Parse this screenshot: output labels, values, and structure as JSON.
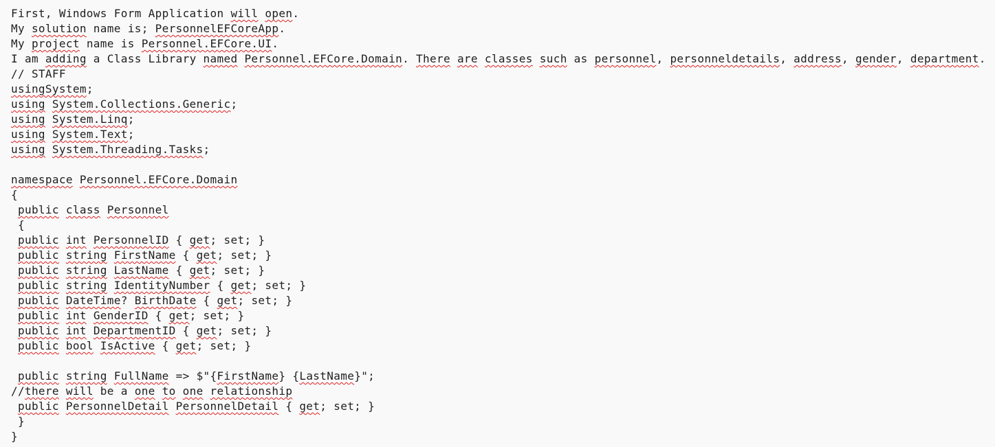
{
  "document": {
    "lines": [
      [
        {
          "t": "First, Windows Form Application "
        },
        {
          "t": "will",
          "s": 1
        },
        {
          "t": " "
        },
        {
          "t": "open",
          "s": 1
        },
        {
          "t": "."
        }
      ],
      [
        {
          "t": "My "
        },
        {
          "t": "solution",
          "s": 1
        },
        {
          "t": " name is; "
        },
        {
          "t": "PersonnelEFCoreApp",
          "s": 1
        },
        {
          "t": "."
        }
      ],
      [
        {
          "t": "My "
        },
        {
          "t": "project",
          "s": 1
        },
        {
          "t": " name is "
        },
        {
          "t": "Personnel.EFCore.UI",
          "s": 1
        },
        {
          "t": "."
        }
      ],
      [
        {
          "t": "I am "
        },
        {
          "t": "adding",
          "s": 1
        },
        {
          "t": " a Class Library "
        },
        {
          "t": "named",
          "s": 1
        },
        {
          "t": " "
        },
        {
          "t": "Personnel.EFCore.Domain",
          "s": 1
        },
        {
          "t": ". "
        },
        {
          "t": "There",
          "s": 1
        },
        {
          "t": " "
        },
        {
          "t": "are",
          "s": 1
        },
        {
          "t": " "
        },
        {
          "t": "classes",
          "s": 1
        },
        {
          "t": " "
        },
        {
          "t": "such",
          "s": 1
        },
        {
          "t": " as "
        },
        {
          "t": "personnel",
          "s": 1
        },
        {
          "t": ", "
        },
        {
          "t": "personneldetails",
          "s": 1
        },
        {
          "t": ", "
        },
        {
          "t": "address",
          "s": 1
        },
        {
          "t": ", "
        },
        {
          "t": "gender",
          "s": 1
        },
        {
          "t": ", "
        },
        {
          "t": "department",
          "s": 1
        },
        {
          "t": "."
        }
      ],
      [
        {
          "t": "// STAFF"
        }
      ],
      [
        {
          "t": "usingSystem",
          "s": 1
        },
        {
          "t": ";"
        }
      ],
      [
        {
          "t": "using",
          "s": 1
        },
        {
          "t": " "
        },
        {
          "t": "System.Collections.Generic",
          "s": 1
        },
        {
          "t": ";"
        }
      ],
      [
        {
          "t": "using",
          "s": 1
        },
        {
          "t": " "
        },
        {
          "t": "System.Linq",
          "s": 1
        },
        {
          "t": ";"
        }
      ],
      [
        {
          "t": "using",
          "s": 1
        },
        {
          "t": " "
        },
        {
          "t": "System.Text",
          "s": 1
        },
        {
          "t": ";"
        }
      ],
      [
        {
          "t": "using",
          "s": 1
        },
        {
          "t": " "
        },
        {
          "t": "System.Threading.Tasks",
          "s": 1
        },
        {
          "t": ";"
        }
      ],
      [
        {
          "t": ""
        }
      ],
      [
        {
          "t": "namespace",
          "s": 1
        },
        {
          "t": " "
        },
        {
          "t": "Personnel.EFCore.Domain",
          "s": 1
        }
      ],
      [
        {
          "t": "{"
        }
      ],
      [
        {
          "t": " "
        },
        {
          "t": "public",
          "s": 1
        },
        {
          "t": " "
        },
        {
          "t": "class",
          "s": 1
        },
        {
          "t": " "
        },
        {
          "t": "Personnel",
          "s": 1
        }
      ],
      [
        {
          "t": " {"
        }
      ],
      [
        {
          "t": " "
        },
        {
          "t": "public",
          "s": 1
        },
        {
          "t": " "
        },
        {
          "t": "int",
          "s": 1
        },
        {
          "t": " "
        },
        {
          "t": "PersonnelID",
          "s": 1
        },
        {
          "t": " { "
        },
        {
          "t": "get",
          "s": 1
        },
        {
          "t": "; set; }"
        }
      ],
      [
        {
          "t": " "
        },
        {
          "t": "public",
          "s": 1
        },
        {
          "t": " "
        },
        {
          "t": "string",
          "s": 1
        },
        {
          "t": " "
        },
        {
          "t": "FirstName",
          "s": 1
        },
        {
          "t": " { "
        },
        {
          "t": "get",
          "s": 1
        },
        {
          "t": "; set; }"
        }
      ],
      [
        {
          "t": " "
        },
        {
          "t": "public",
          "s": 1
        },
        {
          "t": " "
        },
        {
          "t": "string",
          "s": 1
        },
        {
          "t": " "
        },
        {
          "t": "LastName",
          "s": 1
        },
        {
          "t": " { "
        },
        {
          "t": "get",
          "s": 1
        },
        {
          "t": "; set; }"
        }
      ],
      [
        {
          "t": " "
        },
        {
          "t": "public",
          "s": 1
        },
        {
          "t": " "
        },
        {
          "t": "string",
          "s": 1
        },
        {
          "t": " "
        },
        {
          "t": "IdentityNumber",
          "s": 1
        },
        {
          "t": " { "
        },
        {
          "t": "get",
          "s": 1
        },
        {
          "t": "; set; }"
        }
      ],
      [
        {
          "t": " "
        },
        {
          "t": "public",
          "s": 1
        },
        {
          "t": " "
        },
        {
          "t": "DateTime",
          "s": 1
        },
        {
          "t": "? "
        },
        {
          "t": "BirthDate",
          "s": 1
        },
        {
          "t": " { "
        },
        {
          "t": "get",
          "s": 1
        },
        {
          "t": "; set; }"
        }
      ],
      [
        {
          "t": " "
        },
        {
          "t": "public",
          "s": 1
        },
        {
          "t": " "
        },
        {
          "t": "int",
          "s": 1
        },
        {
          "t": " "
        },
        {
          "t": "GenderID",
          "s": 1
        },
        {
          "t": " { "
        },
        {
          "t": "get",
          "s": 1
        },
        {
          "t": "; set; }"
        }
      ],
      [
        {
          "t": " "
        },
        {
          "t": "public",
          "s": 1
        },
        {
          "t": " "
        },
        {
          "t": "int",
          "s": 1
        },
        {
          "t": " "
        },
        {
          "t": "DepartmentID",
          "s": 1
        },
        {
          "t": " { "
        },
        {
          "t": "get",
          "s": 1
        },
        {
          "t": "; set; }"
        }
      ],
      [
        {
          "t": " "
        },
        {
          "t": "public",
          "s": 1
        },
        {
          "t": " "
        },
        {
          "t": "bool",
          "s": 1
        },
        {
          "t": " "
        },
        {
          "t": "IsActive",
          "s": 1
        },
        {
          "t": " { "
        },
        {
          "t": "get",
          "s": 1
        },
        {
          "t": "; set; }"
        }
      ],
      [
        {
          "t": ""
        }
      ],
      [
        {
          "t": " "
        },
        {
          "t": "public",
          "s": 1
        },
        {
          "t": " "
        },
        {
          "t": "string",
          "s": 1
        },
        {
          "t": " "
        },
        {
          "t": "FullName",
          "s": 1
        },
        {
          "t": " => $\"{"
        },
        {
          "t": "FirstName",
          "s": 1
        },
        {
          "t": "} {"
        },
        {
          "t": "LastName",
          "s": 1
        },
        {
          "t": "}\";"
        }
      ],
      [
        {
          "t": "//"
        },
        {
          "t": "there",
          "s": 1
        },
        {
          "t": " "
        },
        {
          "t": "will",
          "s": 1
        },
        {
          "t": " be a "
        },
        {
          "t": "one",
          "s": 1
        },
        {
          "t": " "
        },
        {
          "t": "to",
          "s": 1
        },
        {
          "t": " "
        },
        {
          "t": "one",
          "s": 1
        },
        {
          "t": " "
        },
        {
          "t": "relationship",
          "s": 1
        }
      ],
      [
        {
          "t": " "
        },
        {
          "t": "public",
          "s": 1
        },
        {
          "t": " "
        },
        {
          "t": "PersonnelDetail",
          "s": 1
        },
        {
          "t": " "
        },
        {
          "t": "PersonnelDetail",
          "s": 1
        },
        {
          "t": " { "
        },
        {
          "t": "get",
          "s": 1
        },
        {
          "t": "; set; }"
        }
      ],
      [
        {
          "t": " }"
        }
      ],
      [
        {
          "t": "}"
        }
      ]
    ]
  },
  "colors": {
    "background": "#f9f9f9",
    "text": "#1e1e1e",
    "spellcheck_underline": "#e02020"
  }
}
